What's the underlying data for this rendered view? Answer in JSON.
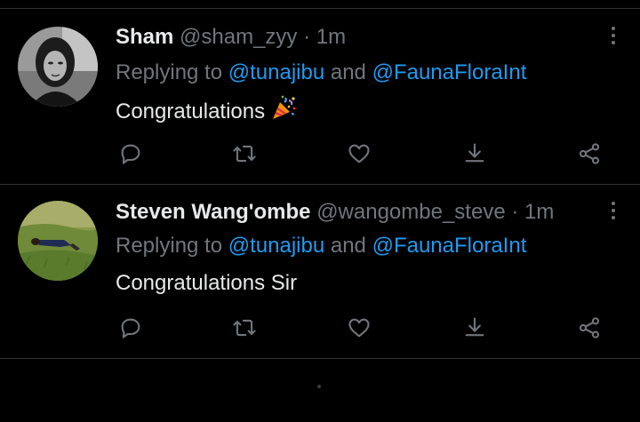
{
  "colors": {
    "background": "#000000",
    "text": "#e7e9ea",
    "muted": "#71767b",
    "link": "#1d9bf0",
    "divider": "#2f3336"
  },
  "tweets": [
    {
      "name": "Sham",
      "handle": "@sham_zyy",
      "separator": "·",
      "time": "1m",
      "replying_prefix": "Replying to ",
      "mention_1": "@tunajibu",
      "replying_and": " and ",
      "mention_2": "@FaunaFloraInt",
      "text": "Congratulations",
      "emoji": "party-popper-icon",
      "avatar": "profile-photo-grayscale"
    },
    {
      "name": "Steven Wang'ombe",
      "handle": "@wangombe_steve",
      "separator": "·",
      "time": "1m",
      "replying_prefix": "Replying to ",
      "mention_1": "@tunajibu",
      "replying_and": " and ",
      "mention_2": "@FaunaFloraInt",
      "text": "Congratulations Sir",
      "avatar": "profile-photo-grass"
    }
  ],
  "action_icons": [
    "reply-icon",
    "retweet-icon",
    "like-icon",
    "download-icon",
    "share-icon"
  ]
}
